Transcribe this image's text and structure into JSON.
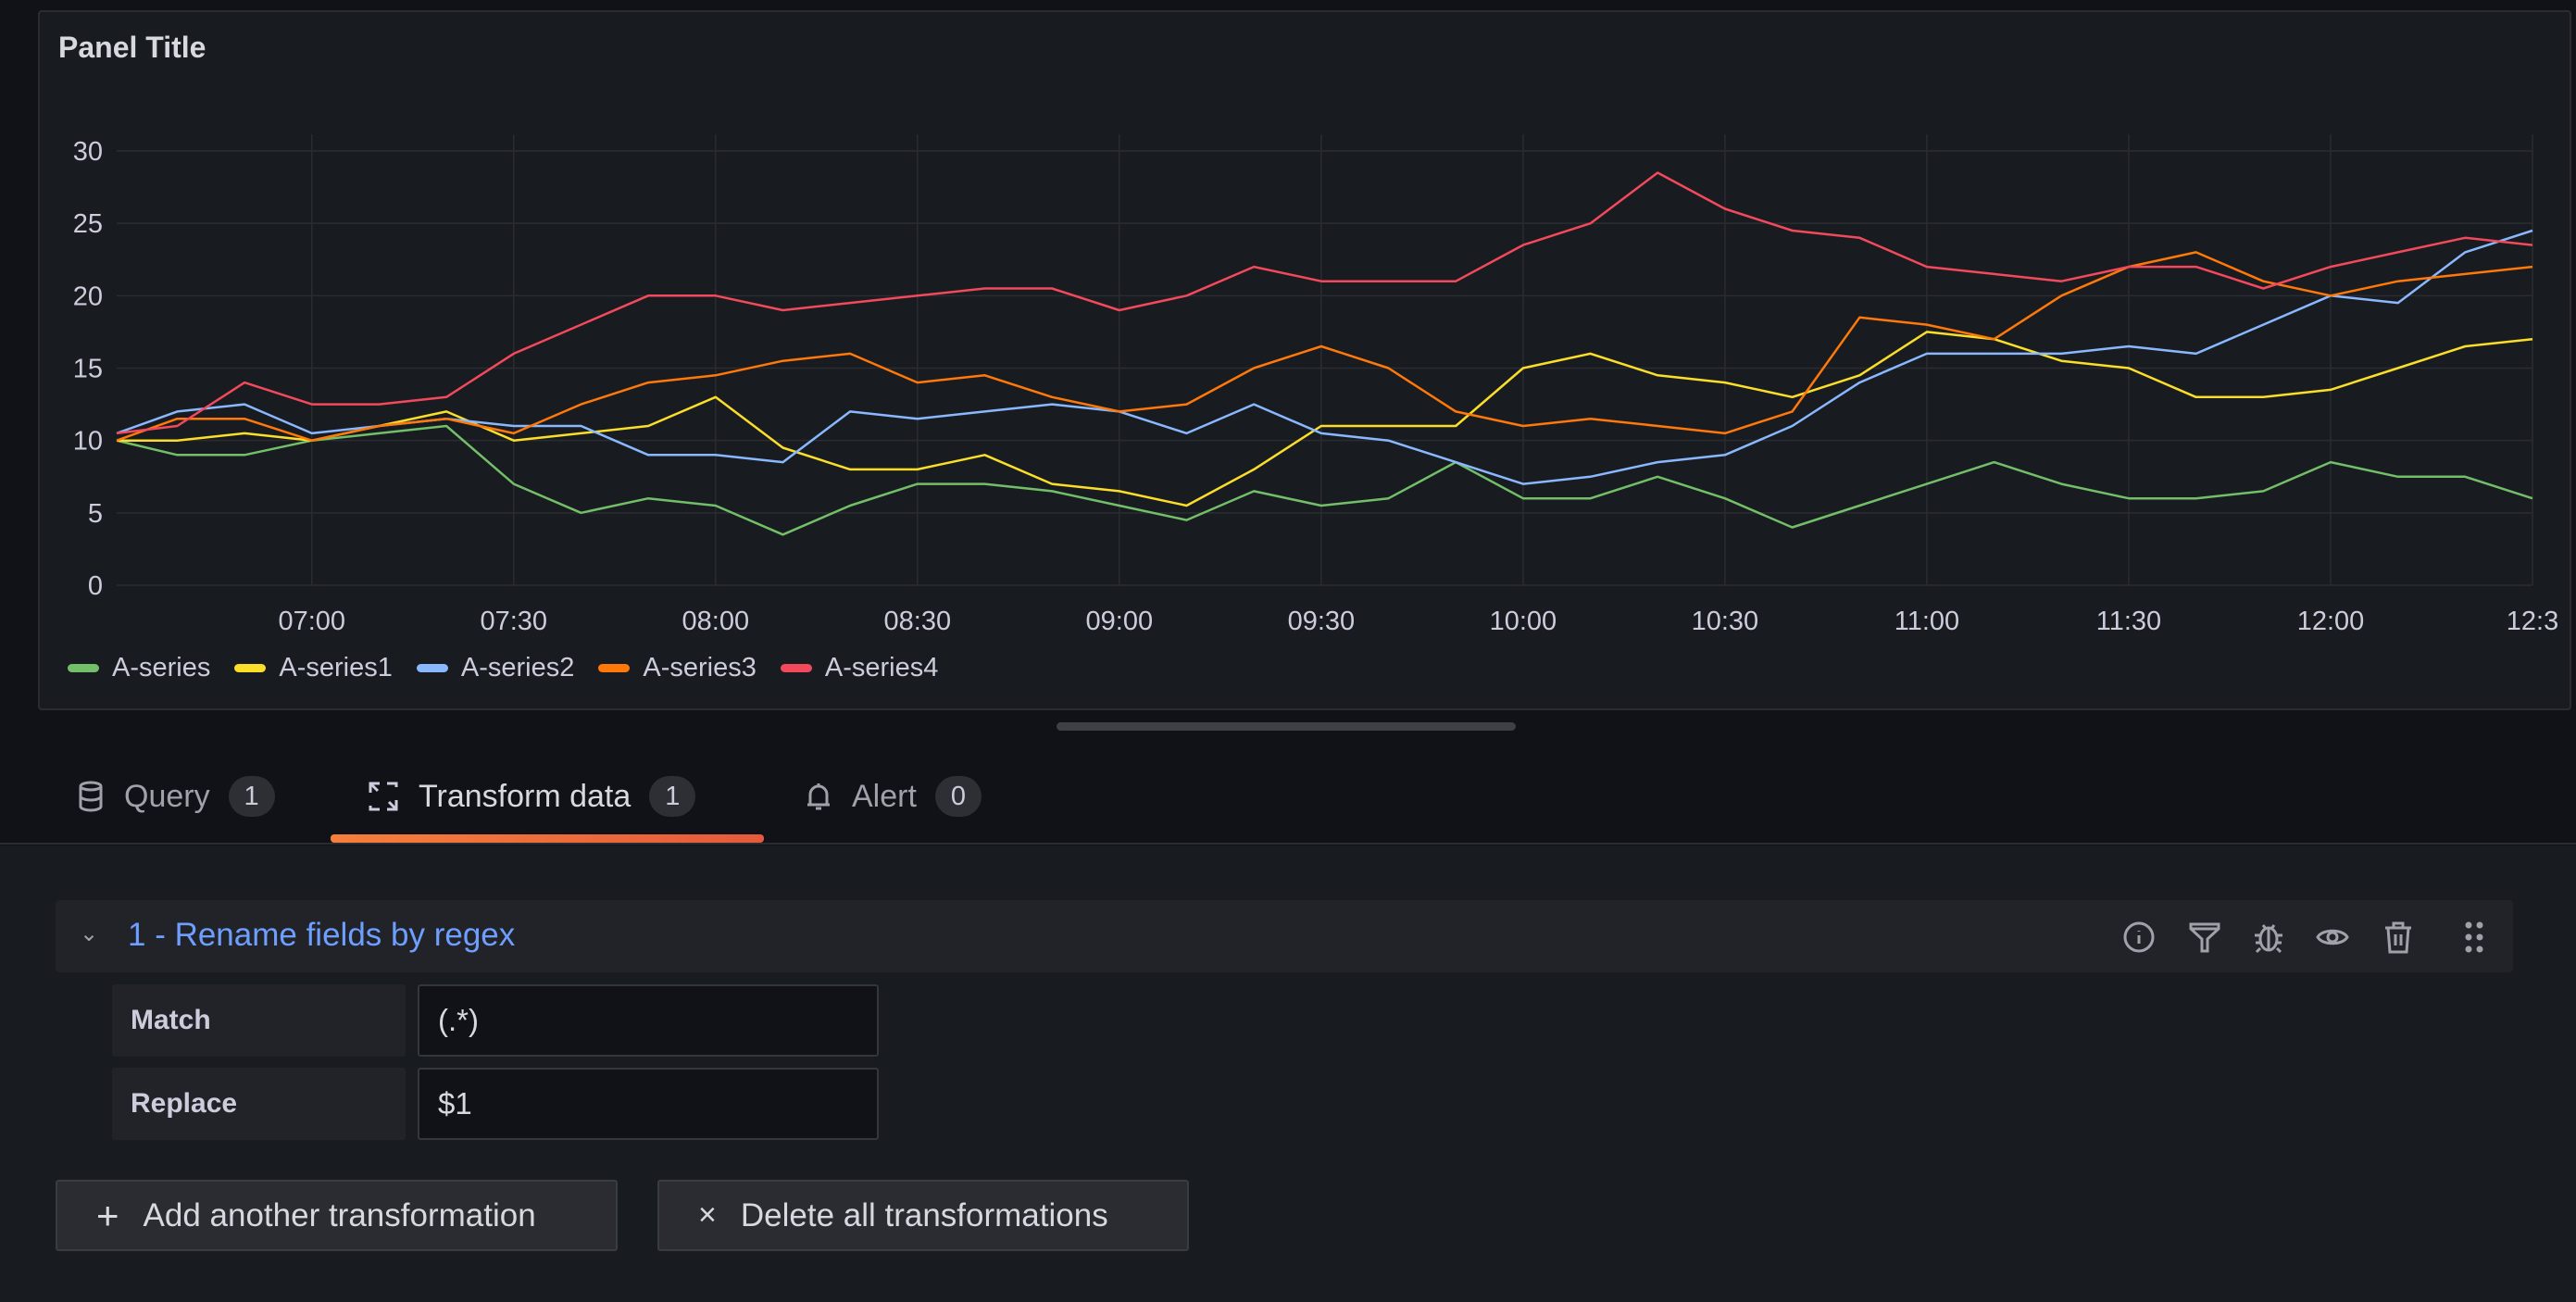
{
  "panel": {
    "title": "Panel Title"
  },
  "chart_data": {
    "type": "line",
    "title": "Panel Title",
    "x": [
      "06:30",
      "06:40",
      "06:50",
      "07:00",
      "07:10",
      "07:20",
      "07:30",
      "07:40",
      "07:50",
      "08:00",
      "08:10",
      "08:20",
      "08:30",
      "08:40",
      "08:50",
      "09:00",
      "09:10",
      "09:20",
      "09:30",
      "09:40",
      "09:50",
      "10:00",
      "10:10",
      "10:20",
      "10:30",
      "10:40",
      "10:50",
      "11:00",
      "11:10",
      "11:20",
      "11:30",
      "11:40",
      "11:50",
      "12:00",
      "12:10",
      "12:20",
      "12:30"
    ],
    "x_ticks": [
      "07:00",
      "07:30",
      "08:00",
      "08:30",
      "09:00",
      "09:30",
      "10:00",
      "10:30",
      "11:00",
      "11:30",
      "12:00",
      "12:3"
    ],
    "y_ticks": [
      "0",
      "5",
      "10",
      "15",
      "20",
      "25",
      "30"
    ],
    "ylim": [
      0,
      30
    ],
    "grid": true,
    "legend_placement": "bottom-left",
    "series": [
      {
        "name": "A-series",
        "color": "#73bf69",
        "values": [
          10,
          9,
          9,
          10,
          10.5,
          11,
          7,
          5,
          6,
          5.5,
          3.5,
          5.5,
          7,
          7,
          6.5,
          5.5,
          4.5,
          6.5,
          5.5,
          6,
          8.5,
          6,
          6,
          7.5,
          6,
          4,
          5.5,
          7,
          8.5,
          7,
          6,
          6,
          6.5,
          8.5,
          7.5,
          7.5,
          6
        ]
      },
      {
        "name": "A-series1",
        "color": "#fade2a",
        "values": [
          10,
          10,
          10.5,
          10,
          11,
          12,
          10,
          10.5,
          11,
          13,
          9.5,
          8,
          8,
          9,
          7,
          6.5,
          5.5,
          8,
          11,
          11,
          11,
          15,
          16,
          14.5,
          14,
          13,
          14.5,
          17.5,
          17,
          15.5,
          15,
          13,
          13,
          13.5,
          15,
          16.5,
          17
        ]
      },
      {
        "name": "A-series2",
        "color": "#8ab8ff",
        "values": [
          10.5,
          12,
          12.5,
          10.5,
          11,
          11.5,
          11,
          11,
          9,
          9,
          8.5,
          12,
          11.5,
          12,
          12.5,
          12,
          10.5,
          12.5,
          10.5,
          10,
          8.5,
          7,
          7.5,
          8.5,
          9,
          11,
          14,
          16,
          16,
          16,
          16.5,
          16,
          18,
          20,
          19.5,
          23,
          24.5
        ]
      },
      {
        "name": "A-series3",
        "color": "#ff780a",
        "values": [
          10,
          11.5,
          11.5,
          10,
          11,
          11.5,
          10.5,
          12.5,
          14,
          14.5,
          15.5,
          16,
          14,
          14.5,
          13,
          12,
          12.5,
          15,
          16.5,
          15,
          12,
          11,
          11.5,
          11,
          10.5,
          12,
          18.5,
          18,
          17,
          20,
          22,
          23,
          21,
          20,
          21,
          21.5,
          22
        ]
      },
      {
        "name": "A-series4",
        "color": "#f2495c",
        "values": [
          10.5,
          11,
          14,
          12.5,
          12.5,
          13,
          16,
          18,
          20,
          20,
          19,
          19.5,
          20,
          20.5,
          20.5,
          19,
          20,
          22,
          21,
          21,
          21,
          23.5,
          25,
          28.5,
          26,
          24.5,
          24,
          22,
          21.5,
          21,
          22,
          22,
          20.5,
          22,
          23,
          24,
          23.5
        ]
      }
    ]
  },
  "tabs": [
    {
      "label": "Query",
      "count": "1",
      "icon": "database-icon"
    },
    {
      "label": "Transform data",
      "count": "1",
      "icon": "transform-icon"
    },
    {
      "label": "Alert",
      "count": "0",
      "icon": "bell-icon"
    }
  ],
  "transformation": {
    "title": "1 - Rename fields by regex",
    "fields": [
      {
        "label": "Match",
        "value": "(.*)"
      },
      {
        "label": "Replace",
        "value": "$1"
      }
    ],
    "icons": [
      "info-icon",
      "filter-icon",
      "bug-icon",
      "eye-icon",
      "trash-icon",
      "drag-handle-icon"
    ]
  },
  "buttons": {
    "add": "Add another transformation",
    "delete": "Delete all transformations"
  },
  "colors": {
    "accent": "#6e9fff",
    "tab_underline": "#f57f3b"
  }
}
